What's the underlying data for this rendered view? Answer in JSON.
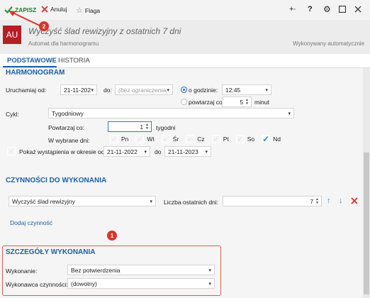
{
  "toolbar": {
    "save_label": "ZAPISZ",
    "cancel_label": "Anuluj",
    "flag_label": "Flaga"
  },
  "title": {
    "badge": "AU",
    "heading": "Wyczyść ślad rewizyjny z ostatnich 7 dni",
    "subtitle": "Automat dla harmonogramu",
    "status": "Wykonywany automatycznie"
  },
  "tabs": [
    {
      "label": "PODSTAWOWE"
    },
    {
      "label": "HISTORIA"
    }
  ],
  "schedule": {
    "title": "HARMONOGRAM",
    "start_label": "Uruchamiaj od:",
    "start_date": "21-11-2022",
    "to_label": "do:",
    "to_placeholder": "(bez ograniczenia)",
    "at_time_label": "o godzinie:",
    "time": "12:45",
    "repeat_every_label": "powtarzaj co:",
    "repeat_every_value": "5",
    "minutes_label": "minut",
    "cycle_label": "Cykl:",
    "cycle_value": "Tygodniowy",
    "repeat_label": "Powtarzaj co:",
    "repeat_value": "1",
    "weeks_label": "tygodni",
    "weekdays_label": "W wybrane dni:",
    "days": [
      {
        "label": "Pn",
        "checked": false
      },
      {
        "label": "Wt",
        "checked": false
      },
      {
        "label": "Śr",
        "checked": false
      },
      {
        "label": "Cz",
        "checked": false
      },
      {
        "label": "Pt",
        "checked": false
      },
      {
        "label": "So",
        "checked": false
      },
      {
        "label": "Nd",
        "checked": true
      }
    ],
    "show_occurrences_label": "Pokaż wystąpienia w okresie od",
    "range_from": "21-11-2022",
    "range_to_label": "do",
    "range_to": "21-11-2023"
  },
  "actions": {
    "title": "CZYNNOŚCI DO WYKONANIA",
    "action_value": "Wyczyść ślad rewizyjny",
    "days_label": "Liczba ostatnich dni:",
    "days_value": "7",
    "add_label": "Dodaj czynność"
  },
  "details": {
    "title": "SZCZEGÓŁY WYKONANIA",
    "execution_label": "Wykonanie:",
    "execution_value": "Bez potwierdzenia",
    "executor_label": "Wykonawca czynności:",
    "executor_value": "(dowolny)"
  },
  "markers": {
    "one": "1",
    "two": "2"
  },
  "colors": {
    "accent": "#1a5fa8",
    "badge_bg": "#b51f24",
    "highlight": "#d9342b",
    "check": "#1e88e5"
  }
}
